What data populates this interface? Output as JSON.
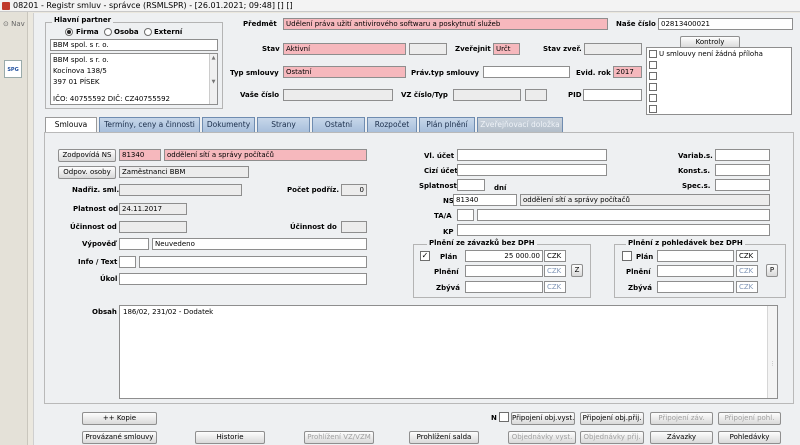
{
  "title": "08201 - Registr smluv - správce (RSMLSPR) - [26.01.2021; 09:48] [] []",
  "nav_label": "Nav",
  "partner": {
    "title": "Hlavní partner",
    "radio_firma": "Firma",
    "radio_osoba": "Osoba",
    "radio_externi": "Externí",
    "code": "BBM spol. s r. o.",
    "addr1": "BBM spol. s r. o.",
    "addr2": "Kocínova 138/5",
    "addr3": "397 01 PÍSEK",
    "ico": "IČO: 40755592 DIČ: CZ40755592"
  },
  "header": {
    "predmet_label": "Předmět",
    "predmet": "Udělení práva užití antivirového softwaru a poskytnutí služeb",
    "nase_cislo_label": "Naše číslo",
    "nase_cislo": "02813400021",
    "kontroly": "Kontroly",
    "stav_label": "Stav",
    "stav": "Aktivní",
    "zverejnit_label": "Zveřejnit",
    "zverejnit": "Určt",
    "stav_zver_label": "Stav zveř.",
    "typ_label": "Typ smlouvy",
    "typ": "Ostatní",
    "prav_typ_label": "Práv.typ smlouvy",
    "evid_rok_label": "Evid. rok",
    "evid_rok": "2017",
    "vase_cislo_label": "Vaše číslo",
    "vz_label": "VZ číslo/Typ",
    "pid_label": "PID",
    "check_item": "U smlouvy není žádná příloha"
  },
  "tabs": [
    "Smlouva",
    "Termíny, ceny a činnosti",
    "Dokumenty",
    "Strany",
    "Ostatní",
    "Rozpočet",
    "Plán plnění",
    "Zveřejňovací doložka"
  ],
  "left": {
    "zodpovida_btn": "Zodpovídá NS",
    "zodpovida_code": "81340",
    "zodpovida_name": "oddělení sítí a správy počítačů",
    "odpov_btn": "Odpov. osoby",
    "odpov_value": "Zaměstnanci BBM",
    "nadriz_label": "Nadřiz. sml.",
    "pocet_label": "Počet podříz.",
    "pocet_value": "0",
    "platnost_label": "Platnost od",
    "platnost_value": "24.11.2017",
    "ucinnost_od_label": "Účinnost od",
    "ucinnost_do_label": "Účinnost do",
    "vypoved_label": "Výpověď",
    "vypoved_value": "Neuvedeno",
    "info_label": "Info / Text",
    "ukol_label": "Úkol"
  },
  "right": {
    "vl_ucet": "Vl. účet",
    "cizi_ucet": "Cizí účet",
    "splatnost": "Splatnost",
    "dni": "dní",
    "ns_label": "NS",
    "ns_code": "81340",
    "ns_name": "oddělení sítí a správy počítačů",
    "ta_label": "TA/A",
    "kp_label": "KP",
    "variab": "Variab.s.",
    "konst": "Konst.s.",
    "spec": "Spec.s."
  },
  "plneni_zavazky": {
    "title": "Plnění ze závazků bez DPH",
    "plan_label": "Plán",
    "plan_value": "25 000.00",
    "currency": "CZK",
    "plneni_label": "Plnění",
    "zbyva_label": "Zbývá",
    "btn": "Z"
  },
  "plneni_pohledavky": {
    "title": "Plnění z pohledávek bez DPH",
    "plan_label": "Plán",
    "currency": "CZK",
    "plneni_label": "Plnění",
    "zbyva_label": "Zbývá",
    "btn": "P"
  },
  "obsah_label": "Obsah",
  "obsah_text": "186/02, 231/02 - Dodatek",
  "buttons_row1": {
    "kopie": "++ Kopie",
    "n_label": "N",
    "pripojeni_obj_vyst": "Připojení obj.vyst.",
    "pripojeni_obj_prij": "Připojení obj.přij.",
    "pripojeni_zav": "Připojení záv.",
    "pripojeni_pohl": "Připojení pohl."
  },
  "buttons_row2": {
    "provazane": "Provázané smlouvy",
    "historie": "Historie",
    "prohlizeni_vz": "Prohlížení VZ/VZM",
    "prohlizeni_salda": "Prohlížení salda",
    "objednavky_vyst": "Objednávky vyst.",
    "objednavky_prij": "Objednávky přij.",
    "zavazky": "Závazky",
    "pohledavky": "Pohledávky"
  }
}
